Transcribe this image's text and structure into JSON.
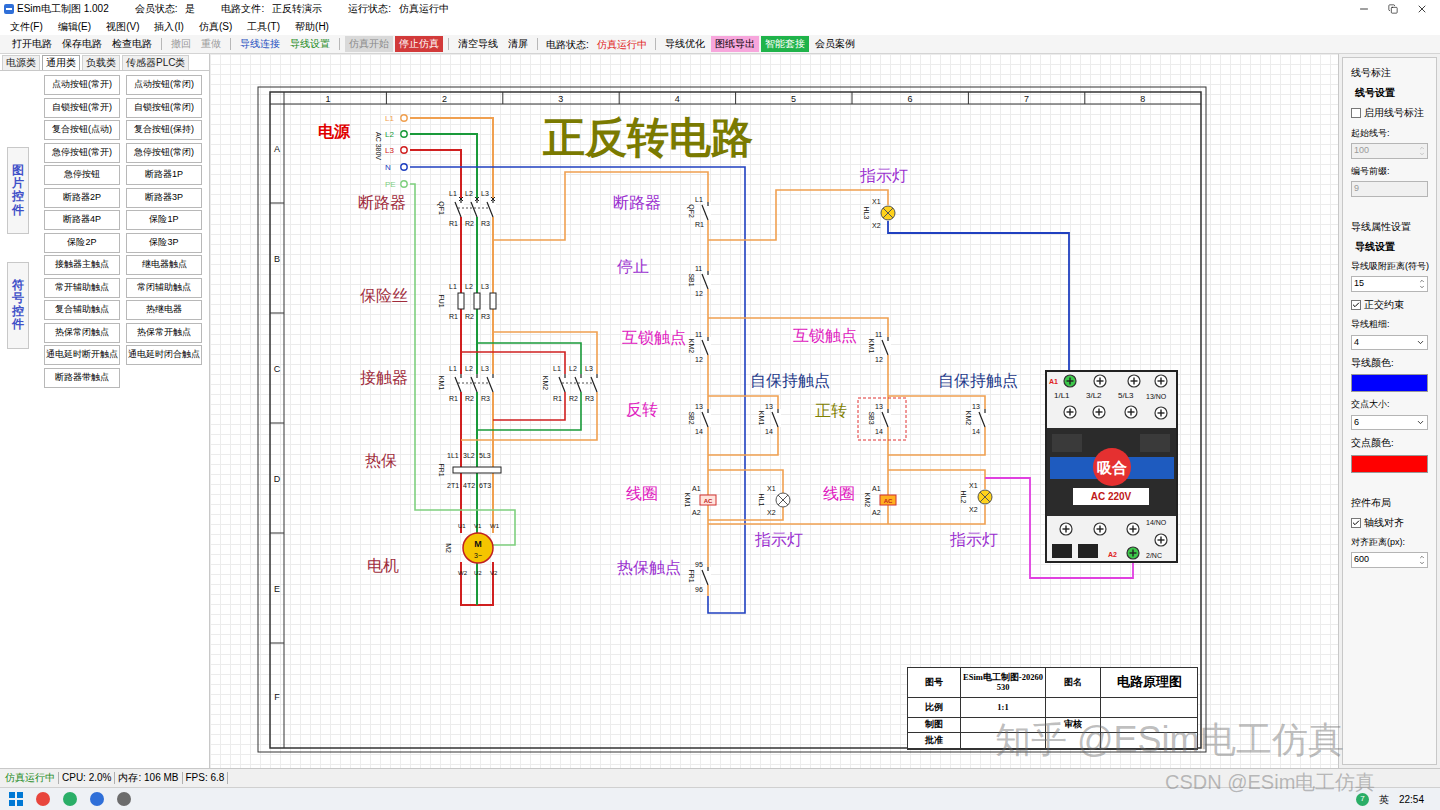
{
  "title_bar": {
    "app": "ESim电工制图 1.002",
    "fields": [
      {
        "label": "会员状态:",
        "value": "是"
      },
      {
        "label": "电路文件:",
        "value": "正反转演示"
      },
      {
        "label": "运行状态:",
        "value": "仿真运行中"
      }
    ]
  },
  "menu": [
    "文件(F)",
    "编辑(E)",
    "视图(V)",
    "插入(I)",
    "仿真(S)",
    "工具(T)",
    "帮助(H)"
  ],
  "toolbar": [
    {
      "kind": "button",
      "label": "打开电路",
      "disabled": false,
      "color": "#000000",
      "fill": null
    },
    {
      "kind": "button",
      "label": "保存电路",
      "disabled": false,
      "color": "#000000",
      "fill": null
    },
    {
      "kind": "button",
      "label": "检查电路",
      "disabled": false,
      "color": "#000000",
      "fill": null
    },
    {
      "kind": "separator"
    },
    {
      "kind": "button",
      "label": "撤回",
      "disabled": true,
      "color": "#9a9a9a",
      "fill": null
    },
    {
      "kind": "button",
      "label": "重做",
      "disabled": true,
      "color": "#9a9a9a",
      "fill": null
    },
    {
      "kind": "separator"
    },
    {
      "kind": "button",
      "label": "导线连接",
      "disabled": false,
      "color": "#1f4fbf",
      "fill": null
    },
    {
      "kind": "button",
      "label": "导线设置",
      "disabled": false,
      "color": "#1a8a1a",
      "fill": null
    },
    {
      "kind": "separator"
    },
    {
      "kind": "button",
      "label": "仿真开始",
      "disabled": true,
      "color": "#8a8a8a",
      "fill": "#d9d9d9"
    },
    {
      "kind": "button",
      "label": "停止仿真",
      "disabled": false,
      "color": "#ffffff",
      "fill": "#d23a3a"
    },
    {
      "kind": "separator"
    },
    {
      "kind": "button",
      "label": "清空导线",
      "disabled": false,
      "color": "#000000",
      "fill": null
    },
    {
      "kind": "button",
      "label": "清屏",
      "disabled": false,
      "color": "#000000",
      "fill": null
    },
    {
      "kind": "separator"
    },
    {
      "kind": "label",
      "label": "电路状态:",
      "color": "#000000"
    },
    {
      "kind": "label",
      "label": "仿真运行中",
      "color": "#e02020"
    },
    {
      "kind": "separator"
    },
    {
      "kind": "button",
      "label": "导线优化",
      "disabled": false,
      "color": "#000000",
      "fill": null
    },
    {
      "kind": "button",
      "label": "图纸导出",
      "disabled": false,
      "color": "#000000",
      "fill": "#f7a6dc"
    },
    {
      "kind": "button",
      "label": "智能套接",
      "disabled": false,
      "color": "#ffffff",
      "fill": "#1fb34a"
    },
    {
      "kind": "button",
      "label": "会员案例",
      "disabled": false,
      "color": "#000000",
      "fill": null
    }
  ],
  "left_panel": {
    "tabs": [
      {
        "label": "电源类",
        "selected": false
      },
      {
        "label": "通用类",
        "selected": true
      },
      {
        "label": "负载类",
        "selected": false
      },
      {
        "label": "传感器PLC类",
        "selected": false
      }
    ],
    "side_buttons": [
      {
        "label": "图片控件",
        "selected": false
      },
      {
        "label": "符号控件",
        "selected": false
      }
    ],
    "items": [
      "点动按钮(常开)",
      "点动按钮(常闭)",
      "自锁按钮(常开)",
      "自锁按钮(常闭)",
      "复合按钮(点动)",
      "复合按钮(保持)",
      "急停按钮(常开)",
      "急停按钮(常闭)",
      "急停按钮",
      "断路器1P",
      "断路器2P",
      "断路器3P",
      "断路器4P",
      "保险1P",
      "保险2P",
      "保险3P",
      "接触器主触点",
      "继电器触点",
      "常开辅助触点",
      "常闭辅助触点",
      "复合辅助触点",
      "热继电器",
      "热保常闭触点",
      "热保常开触点",
      "通电延时断开触点",
      "通电延时闭合触点",
      "断路器带触点"
    ]
  },
  "diagram": {
    "title": "正反转电路",
    "columns": [
      "1",
      "2",
      "3",
      "4",
      "5",
      "6",
      "7",
      "8"
    ],
    "rows": [
      "A",
      "B",
      "C",
      "D",
      "E",
      "F"
    ],
    "power": {
      "voltage": "AC 380V",
      "lines": [
        {
          "label": "L1",
          "color": "#f0a050"
        },
        {
          "label": "L2",
          "color": "#1a9a3a"
        },
        {
          "label": "L3",
          "color": "#d02020"
        },
        {
          "label": "N",
          "color": "#2040c0"
        },
        {
          "label": "PE",
          "color": "#7fd07f"
        }
      ]
    },
    "labels": [
      {
        "text": "电源",
        "color": "#e00000"
      },
      {
        "text": "断路器",
        "color": "#a02c3c"
      },
      {
        "text": "保险丝",
        "color": "#a02c3c"
      },
      {
        "text": "接触器",
        "color": "#a02c3c"
      },
      {
        "text": "热保",
        "color": "#a02c3c"
      },
      {
        "text": "电机",
        "color": "#a02c3c"
      },
      {
        "text": "断路器",
        "color": "#9b30d0"
      },
      {
        "text": "停止",
        "color": "#9b30d0"
      },
      {
        "text": "互锁触点",
        "color": "#e020c0"
      },
      {
        "text": "互锁触点",
        "color": "#e020c0"
      },
      {
        "text": "自保持触点",
        "color": "#1e3a8a"
      },
      {
        "text": "自保持触点",
        "color": "#1e3a8a"
      },
      {
        "text": "反转",
        "color": "#e020c0"
      },
      {
        "text": "正转",
        "color": "#808000"
      },
      {
        "text": "线圈",
        "color": "#e020c0"
      },
      {
        "text": "线圈",
        "color": "#e020c0"
      },
      {
        "text": "指示灯",
        "color": "#9b30d0"
      },
      {
        "text": "指示灯",
        "color": "#9b30d0"
      },
      {
        "text": "指示灯",
        "color": "#9b30d0"
      },
      {
        "text": "热保触点",
        "color": "#9b30d0"
      }
    ],
    "components": [
      {
        "kind": "breaker3",
        "name": "QF1",
        "top": [
          "L1",
          "L2",
          "L3"
        ],
        "bottom": [
          "R1",
          "R2",
          "R3"
        ]
      },
      {
        "kind": "fuse3",
        "name": "FU1",
        "top": [
          "L1",
          "L2",
          "L3"
        ],
        "bottom": [
          "R1",
          "R2",
          "R3"
        ]
      },
      {
        "kind": "contact3",
        "name": "KM1",
        "top": [
          "L1",
          "L2",
          "L3"
        ],
        "bottom": [
          "R1",
          "R2",
          "R3"
        ]
      },
      {
        "kind": "contact3",
        "name": "KM2",
        "top": [
          "L1",
          "L2",
          "L3"
        ],
        "bottom": [
          "R1",
          "R2",
          "R3"
        ]
      },
      {
        "kind": "thermal3",
        "name": "FR1",
        "top": [
          "1L1",
          "3L2",
          "5L3"
        ],
        "bottom": [
          "2T1",
          "4T2",
          "6T3"
        ]
      },
      {
        "kind": "motor",
        "name": "M2",
        "symbol": "M",
        "phase": "3~",
        "top": [
          "U1",
          "V1",
          "W1"
        ],
        "bottom": [
          "W2",
          "U2",
          "V2"
        ]
      },
      {
        "kind": "contact",
        "name": "QF2",
        "top": "L1",
        "bottom": "R1",
        "selected": false
      },
      {
        "kind": "contact",
        "name": "SB1",
        "top": "11",
        "bottom": "12",
        "selected": false
      },
      {
        "kind": "contact",
        "name": "KM2",
        "top": "11",
        "bottom": "12",
        "selected": false
      },
      {
        "kind": "contact",
        "name": "SB2",
        "top": "13",
        "bottom": "14",
        "selected": false
      },
      {
        "kind": "contact",
        "name": "KM1",
        "top": "13",
        "bottom": "14",
        "selected": false
      },
      {
        "kind": "coil",
        "name": "KM1",
        "top": "A1",
        "bottom": "A2",
        "mark": "AC",
        "on": false
      },
      {
        "kind": "lamp",
        "name": "HL1",
        "top": "X1",
        "bottom": "X2",
        "on": false
      },
      {
        "kind": "contact",
        "name": "FR1",
        "top": "95",
        "bottom": "96",
        "selected": false
      },
      {
        "kind": "lamp",
        "name": "HL3",
        "top": "X1",
        "bottom": "X2",
        "on": true
      },
      {
        "kind": "contact",
        "name": "KM1",
        "top": "11",
        "bottom": "12",
        "selected": false
      },
      {
        "kind": "contact",
        "name": "SB3",
        "top": "13",
        "bottom": "14",
        "selected": true
      },
      {
        "kind": "contact",
        "name": "KM2",
        "top": "13",
        "bottom": "14",
        "selected": false
      },
      {
        "kind": "coil",
        "name": "KM2",
        "top": "A1",
        "bottom": "A2",
        "mark": "AC",
        "on": true
      },
      {
        "kind": "lamp",
        "name": "HL2",
        "top": "X1",
        "bottom": "X2",
        "on": true
      }
    ],
    "contactor": {
      "status": "吸合",
      "voltage": "AC 220V",
      "energized": true,
      "coil_terminals": [
        "A1",
        "A2"
      ],
      "top_terminals": [
        "1/L1",
        "3/L2",
        "5/L3",
        "13/NO"
      ],
      "bottom_terminals": [
        "14/NO",
        "2/NC"
      ]
    },
    "title_block": {
      "rows": [
        [
          "图号",
          "ESim电工制图-20260530",
          "图名",
          "电路原理图"
        ],
        [
          "比例",
          "1:1",
          "",
          ""
        ],
        [
          "制图",
          "",
          "审核",
          ""
        ],
        [
          "批准",
          "",
          "",
          ""
        ]
      ]
    }
  },
  "right_panel": {
    "groups": [
      {
        "title": "线号标注",
        "items": [
          {
            "kind": "heading",
            "label": "线号设置"
          },
          {
            "kind": "checkbox",
            "label": "启用线号标注",
            "checked": false
          },
          {
            "kind": "number",
            "label": "起始线号:",
            "value": "100",
            "disabled": true
          },
          {
            "kind": "text",
            "label": "编号前缀:",
            "value": "9",
            "disabled": true
          }
        ]
      },
      {
        "title": "导线属性设置",
        "items": [
          {
            "kind": "heading",
            "label": "导线设置"
          },
          {
            "kind": "number",
            "label": "导线吸附距离(符号)",
            "value": "15",
            "disabled": false
          },
          {
            "kind": "checkbox",
            "label": "正交约束",
            "checked": true
          },
          {
            "kind": "select",
            "label": "导线粗细:",
            "value": "4",
            "disabled": false
          },
          {
            "kind": "color",
            "label": "导线颜色:",
            "color": "#0000ff"
          },
          {
            "kind": "select",
            "label": "交点大小:",
            "value": "6",
            "disabled": false
          },
          {
            "kind": "color",
            "label": "交点颜色:",
            "color": "#ff0000"
          }
        ]
      },
      {
        "title": "控件布局",
        "items": [
          {
            "kind": "checkbox",
            "label": "轴线对齐",
            "checked": true
          },
          {
            "kind": "number",
            "label": "对齐距离(px):",
            "value": "600",
            "disabled": false
          }
        ]
      }
    ]
  },
  "status_bar": [
    {
      "text": "仿真运行中",
      "color": "#1a8a1a"
    },
    {
      "text": "CPU: 2.0%",
      "color": "#000000"
    },
    {
      "text": "内存: 106 MB",
      "color": "#000000"
    },
    {
      "text": "FPS: 6.8",
      "color": "#000000"
    }
  ],
  "taskbar": {
    "badge": "7",
    "tray": [
      "英"
    ],
    "time": "22:54"
  },
  "watermarks": [
    "知乎 @ESim电工仿真",
    "CSDN @ESim电工仿真"
  ]
}
